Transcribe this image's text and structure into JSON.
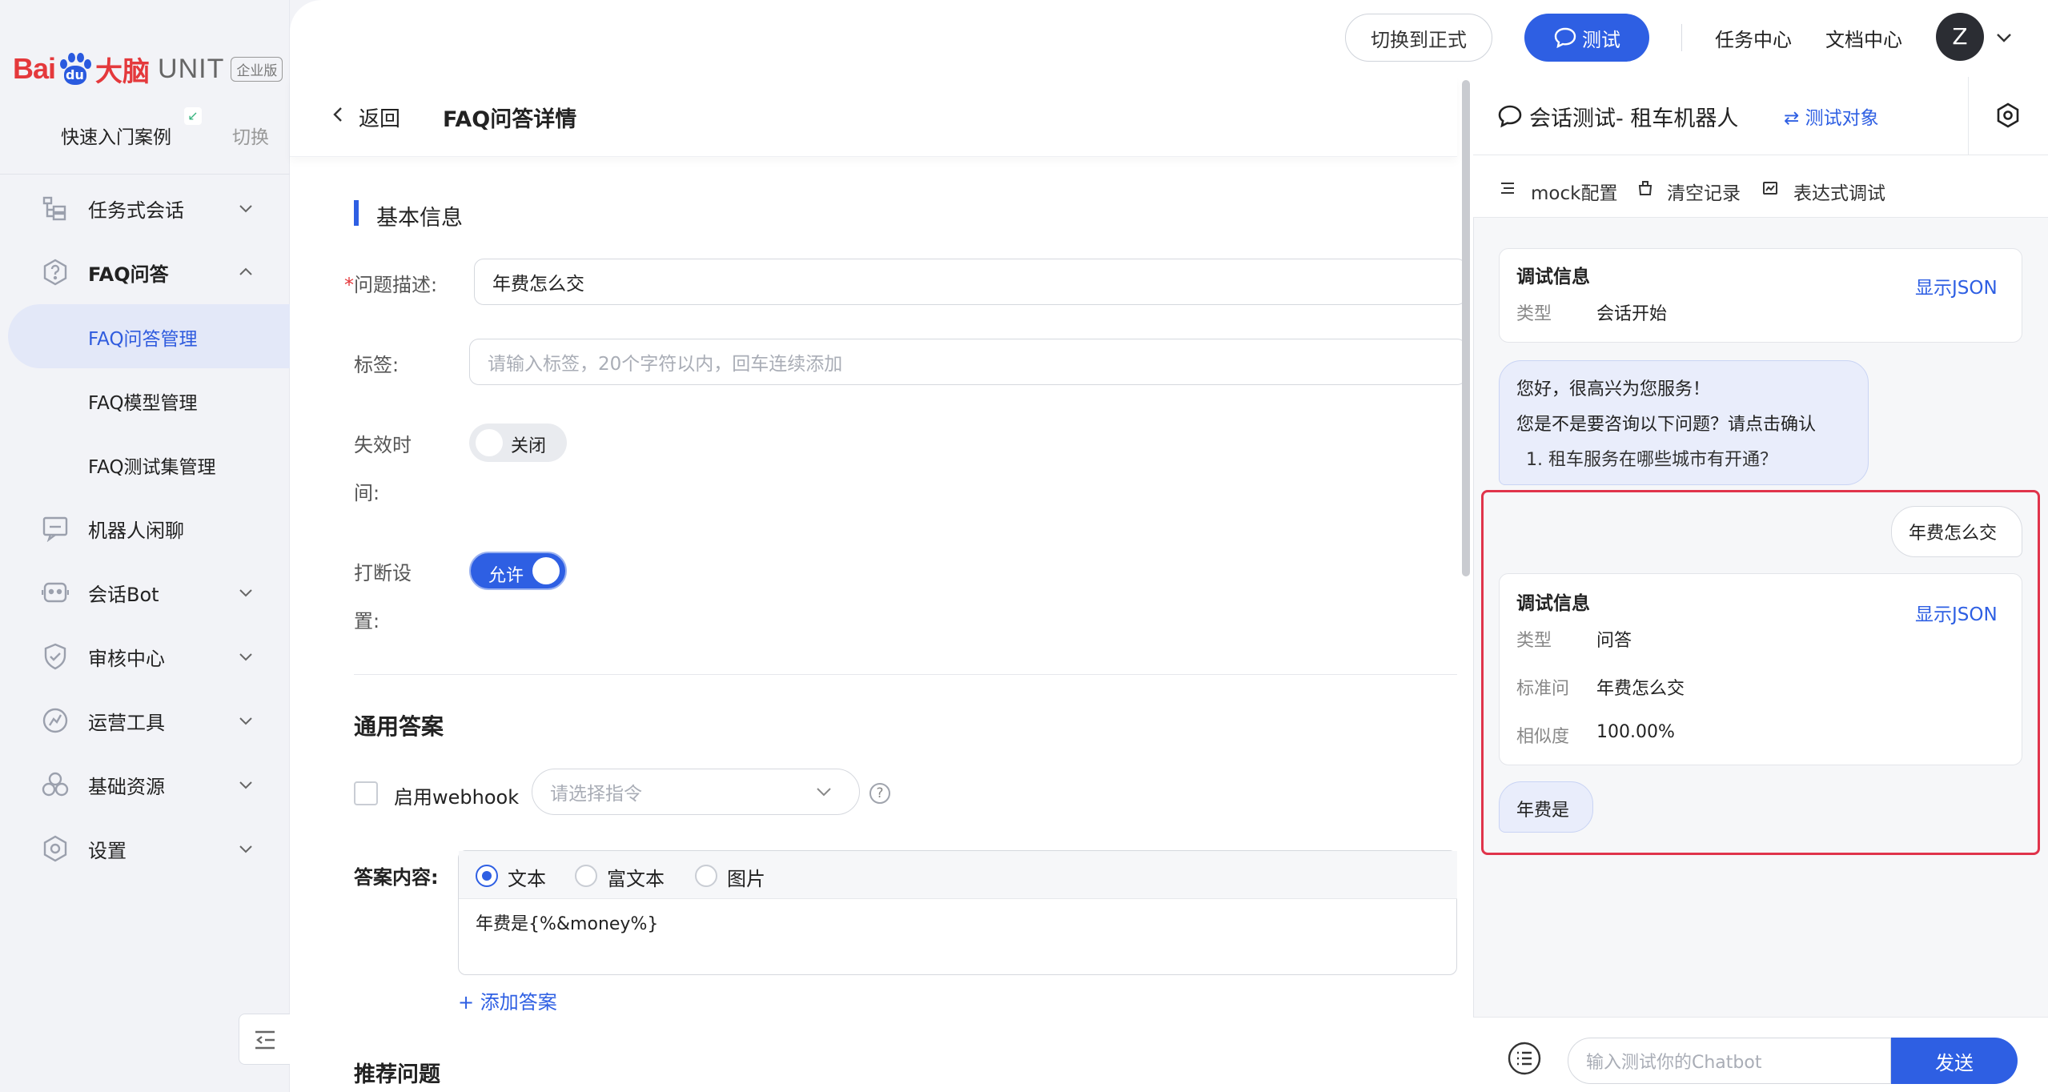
{
  "sidebar": {
    "logo": {
      "bai": "Bai",
      "du": "du",
      "brain": "大脑",
      "unit": "UNIT",
      "edition": "企业版"
    },
    "quick_start": "快速入门案例",
    "switch": "切换",
    "items": [
      {
        "label": "任务式会话",
        "icon": "task-dialog-icon",
        "expanded": false
      },
      {
        "label": "FAQ问答",
        "icon": "faq-icon",
        "expanded": true
      },
      {
        "label": "机器人闲聊",
        "icon": "chitchat-icon"
      },
      {
        "label": "会话Bot",
        "icon": "bot-icon",
        "expanded": false
      },
      {
        "label": "审核中心",
        "icon": "review-shield-icon",
        "expanded": false
      },
      {
        "label": "运营工具",
        "icon": "ops-tool-icon",
        "expanded": false
      },
      {
        "label": "基础资源",
        "icon": "resources-icon",
        "expanded": false
      },
      {
        "label": "设置",
        "icon": "settings-hex-icon",
        "expanded": false
      }
    ],
    "faq_sub": [
      {
        "label": "FAQ问答管理",
        "active": true
      },
      {
        "label": "FAQ模型管理"
      },
      {
        "label": "FAQ测试集管理"
      }
    ]
  },
  "topbar": {
    "switch_prod": "切换到正式",
    "test": "测试",
    "task_center": "任务中心",
    "doc_center": "文档中心",
    "avatar_letter": "Z"
  },
  "main": {
    "back": "返回",
    "title": "FAQ问答详情",
    "basic_info": "基本信息",
    "question_label": "问题描述:",
    "question_value": "年费怎么交",
    "tags_label": "标签:",
    "tags_placeholder": "请输入标签，20个字符以内，回车连续添加",
    "expire_label_1": "失效时",
    "expire_label_2": "间:",
    "expire_toggle": "关闭",
    "interrupt_label_1": "打断设",
    "interrupt_label_2": "置:",
    "interrupt_toggle": "允许",
    "general_answer": "通用答案",
    "webhook_label": "启用webhook",
    "command_placeholder": "请选择指令",
    "answer_label": "答案内容:",
    "answer_types": [
      "文本",
      "富文本",
      "图片"
    ],
    "answer_text": "年费是{%&money%}",
    "add_answer": "+ 添加答案",
    "recommend": "推荐问题"
  },
  "chat": {
    "title": "会话测试- 租车机器人",
    "test_target": "⇄ 测试对象",
    "tools": [
      "mock配置",
      "清空记录",
      "表达式调试"
    ],
    "debug1": {
      "title": "调试信息",
      "json": "显示JSON",
      "type_key": "类型",
      "type_val": "会话开始"
    },
    "bot_greeting": [
      "您好，很高兴为您服务！",
      "您是不是要咨询以下问题？请点击确认",
      "1. 租车服务在哪些城市有开通？"
    ],
    "user_msg": "年费怎么交",
    "debug2": {
      "title": "调试信息",
      "json": "显示JSON",
      "type_key": "类型",
      "type_val": "问答",
      "std_key": "标准问",
      "std_val": "年费怎么交",
      "sim_key": "相似度",
      "sim_val": "100.00%"
    },
    "bot_reply": "年费是",
    "input_placeholder": "输入测试你的Chatbot",
    "send": "发送"
  },
  "colors": {
    "accent": "#2e5fe3",
    "highlight": "#e0344b",
    "logo_red": "#e4393c"
  }
}
